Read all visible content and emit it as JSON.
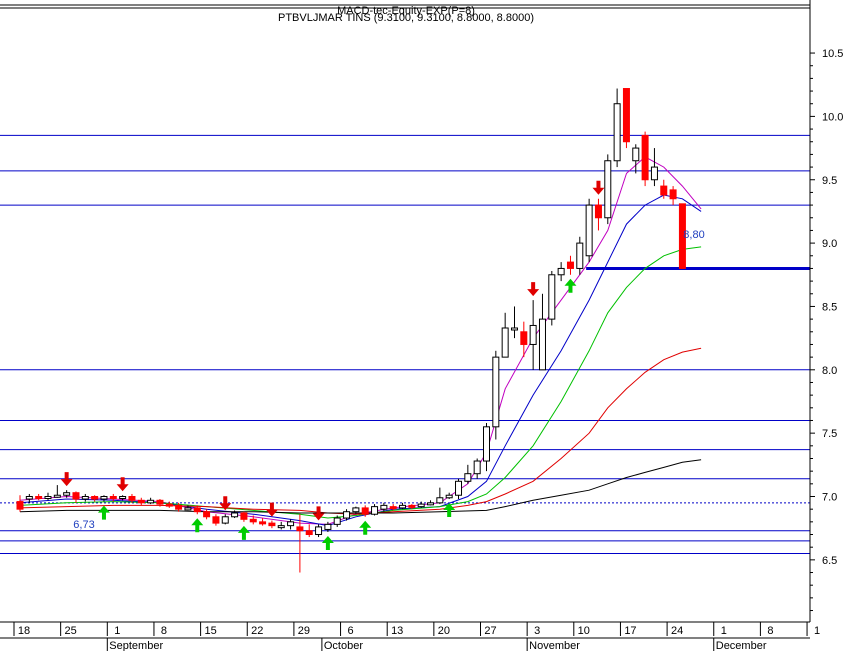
{
  "chart_data": {
    "type": "candlestick",
    "header_line1": "MACD-tec-Equity-EXP(P=8)",
    "header_line2": "PTBVLJMAR TINS (9.3100, 9.3100, 8.8000, 8.8000)",
    "ylim": [
      6.0,
      10.7
    ],
    "y_ticks": [
      10.5,
      10.0,
      9.5,
      9.0,
      8.5,
      8.0,
      7.5,
      7.0,
      6.5
    ],
    "y_tick_labels": [
      "10.5",
      "10.0",
      "9.5",
      "9.0",
      "8.5",
      "8.0",
      "7.5",
      "7.0",
      "6.5"
    ],
    "x_ticks": [
      {
        "idx": 0,
        "label": "18"
      },
      {
        "idx": 5,
        "label": "25"
      },
      {
        "idx": 10,
        "label": "1"
      },
      {
        "idx": 15,
        "label": "8"
      },
      {
        "idx": 20,
        "label": "15"
      },
      {
        "idx": 25,
        "label": "22"
      },
      {
        "idx": 30,
        "label": "29"
      },
      {
        "idx": 35,
        "label": "6"
      },
      {
        "idx": 40,
        "label": "13"
      },
      {
        "idx": 45,
        "label": "20"
      },
      {
        "idx": 50,
        "label": "27"
      },
      {
        "idx": 55,
        "label": "3"
      },
      {
        "idx": 60,
        "label": "10"
      },
      {
        "idx": 65,
        "label": "17"
      },
      {
        "idx": 70,
        "label": "24"
      },
      {
        "idx": 75,
        "label": "1"
      },
      {
        "idx": 80,
        "label": "8"
      },
      {
        "idx": 85,
        "label": "1"
      }
    ],
    "months": [
      {
        "idx": 10,
        "label": "September"
      },
      {
        "idx": 33,
        "label": "October"
      },
      {
        "idx": 55,
        "label": "November"
      },
      {
        "idx": 75,
        "label": "December"
      }
    ],
    "hlines": [
      9.85,
      9.57,
      9.3,
      8.0,
      7.6,
      7.37,
      7.14,
      6.73,
      6.65,
      6.55
    ],
    "hlines_lower": [
      6.0
    ],
    "support_line": {
      "value": 8.8,
      "label": "8,80",
      "from_idx": 61
    },
    "dotted_line": 6.95,
    "low_label": {
      "value": 6.73,
      "label": "6,73"
    },
    "candles": [
      [
        6.96,
        6.9,
        7.01,
        6.88
      ],
      [
        6.98,
        7.0,
        7.02,
        6.95
      ],
      [
        7.0,
        6.99,
        7.02,
        6.97
      ],
      [
        6.99,
        7.0,
        7.03,
        6.97
      ],
      [
        7.0,
        7.01,
        7.09,
        6.99
      ],
      [
        7.01,
        7.03,
        7.05,
        6.99
      ],
      [
        7.03,
        6.98,
        7.04,
        6.95
      ],
      [
        6.98,
        7.0,
        7.02,
        6.96
      ],
      [
        7.0,
        6.98,
        7.01,
        6.96
      ],
      [
        6.98,
        7.0,
        7.01,
        6.96
      ],
      [
        7.0,
        6.99,
        7.02,
        6.96
      ],
      [
        6.99,
        7.0,
        7.01,
        6.97
      ],
      [
        7.0,
        6.97,
        7.02,
        6.95
      ],
      [
        6.97,
        6.95,
        6.99,
        6.93
      ],
      [
        6.95,
        6.97,
        6.99,
        6.94
      ],
      [
        6.97,
        6.94,
        6.98,
        6.92
      ],
      [
        6.94,
        6.93,
        6.96,
        6.91
      ],
      [
        6.93,
        6.9,
        6.95,
        6.88
      ],
      [
        6.9,
        6.91,
        6.93,
        6.89
      ],
      [
        6.91,
        6.88,
        6.93,
        6.86
      ],
      [
        6.88,
        6.84,
        6.9,
        6.82
      ],
      [
        6.84,
        6.79,
        6.86,
        6.77
      ],
      [
        6.79,
        6.84,
        6.86,
        6.78
      ],
      [
        6.84,
        6.87,
        6.89,
        6.83
      ],
      [
        6.87,
        6.82,
        6.88,
        6.8
      ],
      [
        6.82,
        6.8,
        6.85,
        6.78
      ],
      [
        6.8,
        6.79,
        6.83,
        6.77
      ],
      [
        6.79,
        6.77,
        6.81,
        6.75
      ],
      [
        6.77,
        6.77,
        6.8,
        6.74
      ],
      [
        6.77,
        6.8,
        6.82,
        6.74
      ],
      [
        6.76,
        6.73,
        6.86,
        6.4
      ],
      [
        6.73,
        6.7,
        6.78,
        6.68
      ],
      [
        6.7,
        6.76,
        6.78,
        6.68
      ],
      [
        6.74,
        6.78,
        6.8,
        6.72
      ],
      [
        6.78,
        6.83,
        6.85,
        6.76
      ],
      [
        6.83,
        6.88,
        6.9,
        6.81
      ],
      [
        6.88,
        6.91,
        6.92,
        6.86
      ],
      [
        6.91,
        6.86,
        6.93,
        6.84
      ],
      [
        6.86,
        6.92,
        6.94,
        6.85
      ],
      [
        6.9,
        6.93,
        6.95,
        6.88
      ],
      [
        6.92,
        6.91,
        6.94,
        6.89
      ],
      [
        6.91,
        6.93,
        6.95,
        6.9
      ],
      [
        6.93,
        6.92,
        6.94,
        6.9
      ],
      [
        6.92,
        6.94,
        6.96,
        6.91
      ],
      [
        6.94,
        6.95,
        6.97,
        6.93
      ],
      [
        6.95,
        6.99,
        7.07,
        6.94
      ],
      [
        6.99,
        7.01,
        7.03,
        6.98
      ],
      [
        7.01,
        7.12,
        7.14,
        6.98
      ],
      [
        7.12,
        7.18,
        7.25,
        7.1
      ],
      [
        7.18,
        7.28,
        7.3,
        7.14
      ],
      [
        7.28,
        7.55,
        7.58,
        7.2
      ],
      [
        7.55,
        8.1,
        8.15,
        7.45
      ],
      [
        8.1,
        8.33,
        8.45,
        8.1
      ],
      [
        8.33,
        8.33,
        8.5,
        8.25
      ],
      [
        8.3,
        8.2,
        8.38,
        8.1
      ],
      [
        8.2,
        8.35,
        8.55,
        8.0
      ],
      [
        8.0,
        8.4,
        8.6,
        8.0
      ],
      [
        8.4,
        8.75,
        8.78,
        8.35
      ],
      [
        8.75,
        8.8,
        8.85,
        8.7
      ],
      [
        8.85,
        8.8,
        8.9,
        8.75
      ],
      [
        8.8,
        9.0,
        9.05,
        8.75
      ],
      [
        8.9,
        9.3,
        9.35,
        8.85
      ],
      [
        9.3,
        9.2,
        9.35,
        9.1
      ],
      [
        9.2,
        9.65,
        9.7,
        9.15
      ],
      [
        9.65,
        10.1,
        10.22,
        9.6
      ],
      [
        10.22,
        9.8,
        10.22,
        9.75
      ],
      [
        9.65,
        9.75,
        9.78,
        9.55
      ],
      [
        9.85,
        9.5,
        9.88,
        9.45
      ],
      [
        9.5,
        9.6,
        9.75,
        9.45
      ],
      [
        9.45,
        9.38,
        9.5,
        9.35
      ],
      [
        9.42,
        9.35,
        9.45,
        9.3
      ],
      [
        9.31,
        8.8,
        9.31,
        8.8
      ]
    ],
    "series": [
      {
        "name": "",
        "color": "#c000c0",
        "values": [
          [
            0,
            6.97
          ],
          [
            5,
            7.0
          ],
          [
            10,
            6.98
          ],
          [
            15,
            6.96
          ],
          [
            20,
            6.88
          ],
          [
            25,
            6.84
          ],
          [
            30,
            6.79
          ],
          [
            33,
            6.78
          ],
          [
            36,
            6.86
          ],
          [
            40,
            6.91
          ],
          [
            45,
            6.95
          ],
          [
            48,
            7.1
          ],
          [
            50,
            7.35
          ],
          [
            52,
            7.85
          ],
          [
            55,
            8.25
          ],
          [
            58,
            8.55
          ],
          [
            61,
            8.85
          ],
          [
            63,
            9.1
          ],
          [
            65,
            9.55
          ],
          [
            67,
            9.68
          ],
          [
            69,
            9.6
          ],
          [
            71,
            9.45
          ],
          [
            73,
            9.27
          ]
        ]
      },
      {
        "name": "",
        "color": "#0000c8",
        "values": [
          [
            0,
            6.95
          ],
          [
            5,
            6.98
          ],
          [
            10,
            6.97
          ],
          [
            15,
            6.95
          ],
          [
            20,
            6.9
          ],
          [
            25,
            6.86
          ],
          [
            30,
            6.81
          ],
          [
            33,
            6.77
          ],
          [
            36,
            6.84
          ],
          [
            40,
            6.9
          ],
          [
            45,
            6.92
          ],
          [
            48,
            7.0
          ],
          [
            50,
            7.12
          ],
          [
            52,
            7.4
          ],
          [
            55,
            7.8
          ],
          [
            58,
            8.15
          ],
          [
            61,
            8.55
          ],
          [
            63,
            8.85
          ],
          [
            65,
            9.15
          ],
          [
            67,
            9.3
          ],
          [
            69,
            9.38
          ],
          [
            71,
            9.35
          ],
          [
            73,
            9.25
          ]
        ]
      },
      {
        "name": "",
        "color": "#00c000",
        "values": [
          [
            0,
            6.93
          ],
          [
            5,
            6.95
          ],
          [
            10,
            6.96
          ],
          [
            15,
            6.95
          ],
          [
            20,
            6.92
          ],
          [
            25,
            6.89
          ],
          [
            30,
            6.86
          ],
          [
            33,
            6.83
          ],
          [
            36,
            6.85
          ],
          [
            40,
            6.89
          ],
          [
            45,
            6.92
          ],
          [
            48,
            6.96
          ],
          [
            50,
            7.02
          ],
          [
            52,
            7.15
          ],
          [
            55,
            7.4
          ],
          [
            58,
            7.75
          ],
          [
            61,
            8.15
          ],
          [
            63,
            8.45
          ],
          [
            65,
            8.65
          ],
          [
            67,
            8.8
          ],
          [
            69,
            8.9
          ],
          [
            71,
            8.95
          ],
          [
            73,
            8.97
          ]
        ]
      },
      {
        "name": "",
        "color": "#e00000",
        "values": [
          [
            0,
            6.91
          ],
          [
            5,
            6.92
          ],
          [
            10,
            6.93
          ],
          [
            15,
            6.93
          ],
          [
            20,
            6.92
          ],
          [
            25,
            6.9
          ],
          [
            30,
            6.89
          ],
          [
            33,
            6.87
          ],
          [
            36,
            6.86
          ],
          [
            40,
            6.88
          ],
          [
            45,
            6.9
          ],
          [
            48,
            6.93
          ],
          [
            50,
            6.96
          ],
          [
            52,
            7.02
          ],
          [
            55,
            7.12
          ],
          [
            58,
            7.3
          ],
          [
            61,
            7.5
          ],
          [
            63,
            7.7
          ],
          [
            65,
            7.85
          ],
          [
            67,
            7.98
          ],
          [
            69,
            8.08
          ],
          [
            71,
            8.14
          ],
          [
            73,
            8.17
          ]
        ]
      },
      {
        "name": "",
        "color": "#000000",
        "values": [
          [
            0,
            6.88
          ],
          [
            5,
            6.89
          ],
          [
            10,
            6.89
          ],
          [
            15,
            6.89
          ],
          [
            20,
            6.88
          ],
          [
            25,
            6.88
          ],
          [
            30,
            6.87
          ],
          [
            35,
            6.87
          ],
          [
            40,
            6.87
          ],
          [
            45,
            6.88
          ],
          [
            50,
            6.89
          ],
          [
            52,
            6.92
          ],
          [
            55,
            6.97
          ],
          [
            58,
            7.01
          ],
          [
            61,
            7.05
          ],
          [
            63,
            7.1
          ],
          [
            65,
            7.15
          ],
          [
            67,
            7.19
          ],
          [
            69,
            7.23
          ],
          [
            71,
            7.27
          ],
          [
            73,
            7.29
          ]
        ]
      }
    ],
    "buy_signals": [
      9,
      19,
      24,
      33,
      37,
      46,
      59
    ],
    "sell_signals": [
      5,
      11,
      22,
      27,
      32,
      55,
      62
    ],
    "colors": {
      "up": "#ffffff",
      "down": "#ff0000",
      "grid": "#0000c8",
      "axis": "#000000",
      "buy": "#00cc00",
      "sell": "#e00000"
    }
  }
}
